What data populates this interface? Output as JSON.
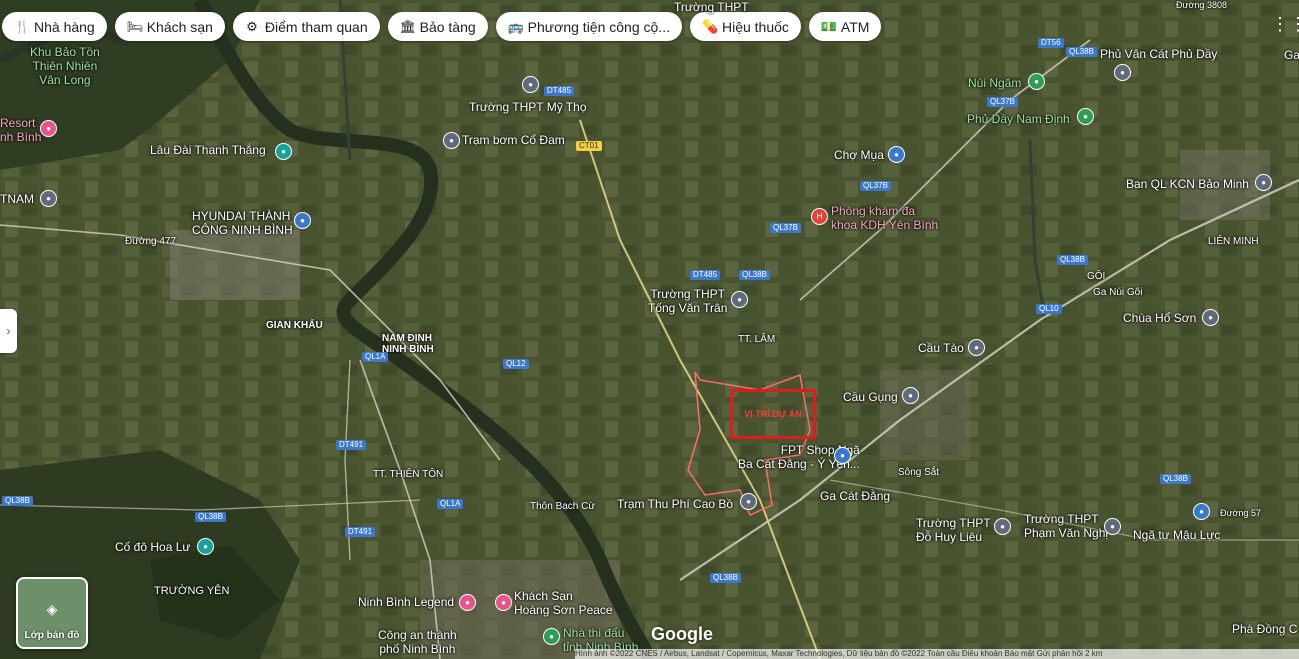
{
  "chips": [
    {
      "icon": "🍴",
      "label": "Nhà hàng"
    },
    {
      "icon": "🛏",
      "label": "Khách sạn"
    },
    {
      "icon": "⚙",
      "label": "Điểm tham quan"
    },
    {
      "icon": "🏛",
      "label": "Bảo tàng"
    },
    {
      "icon": "🚌",
      "label": "Phương tiện công cộ..."
    },
    {
      "icon": "💊",
      "label": "Hiệu thuốc"
    },
    {
      "icon": "💵",
      "label": "ATM"
    }
  ],
  "grid_icon": "apps-grid-icon",
  "side_toggle": "›",
  "layer_button": {
    "label": "Lớp bản đồ",
    "icon": "layers-icon"
  },
  "brand": "Google",
  "footer": "Hình ảnh ©2022 CNES / Airbus, Landsat / Copernicus, Maxar Technologies, Dữ liệu bản đồ ©2022   Toàn cầu   Điều khoản   Bảo mật   Gửi phản hồi   2 km",
  "project_label": "VỊ TRÍ DỰ ÁN",
  "places": [
    {
      "t": "Khu Bảo Tồn\nThiên Nhiên\nVân Long",
      "c": "green"
    },
    {
      "t": "Resort\nnh Bình",
      "c": "pink"
    },
    {
      "t": "Lâu Đài Thanh Thắng",
      "c": ""
    },
    {
      "t": "HYUNDAI THÀNH\nCÔNG NINH BÌNH",
      "c": ""
    },
    {
      "t": "TNAM",
      "c": ""
    },
    {
      "t": "Đường 477",
      "c": ""
    },
    {
      "t": "GIAN KHẨU",
      "c": "bold"
    },
    {
      "t": "NAM ĐỊNH\nNINH BÌNH",
      "c": "bold"
    },
    {
      "t": "TT. THIÊN TÔN",
      "c": ""
    },
    {
      "t": "Cố đô Hoa Lư",
      "c": ""
    },
    {
      "t": "TRƯỜNG YÊN",
      "c": ""
    },
    {
      "t": "Ninh Bình Legend",
      "c": ""
    },
    {
      "t": "Khách Sạn\nHoàng Sơn Peace",
      "c": ""
    },
    {
      "t": "Công an thành\nphố Ninh Bình",
      "c": ""
    },
    {
      "t": "Nhà thi đấu\ntỉnh Ninh Bình",
      "c": "green"
    },
    {
      "t": "Thôn Bạch Cừ",
      "c": ""
    },
    {
      "t": "Trạm Thu Phí Cao Bồ",
      "c": ""
    },
    {
      "t": "Trường THPT Mỹ Thọ",
      "c": ""
    },
    {
      "t": "Trạm bơm Cổ Đam",
      "c": ""
    },
    {
      "t": "Trường THPT\nTống Văn Trân",
      "c": ""
    },
    {
      "t": "TT. LÂM",
      "c": ""
    },
    {
      "t": "Chợ Mụa",
      "c": ""
    },
    {
      "t": "Phòng khám đa\nkhoa KDH Yên Bình",
      "c": "pink"
    },
    {
      "t": "FPT Shop Ngã\nBa Cát Đằng - Ý Yên...",
      "c": ""
    },
    {
      "t": "Ga Cát Đằng",
      "c": ""
    },
    {
      "t": "Cầu Gụng",
      "c": ""
    },
    {
      "t": "Cầu Tào",
      "c": ""
    },
    {
      "t": "Sông Sắt",
      "c": ""
    },
    {
      "t": "Trường THPT\nĐỗ Huy Liêu",
      "c": ""
    },
    {
      "t": "Trường THPT\nPhạm Văn Nghị",
      "c": ""
    },
    {
      "t": "Ngã tư Mậu Lực",
      "c": ""
    },
    {
      "t": "Chùa Hổ Sơn",
      "c": ""
    },
    {
      "t": "Ga Núi Gôi",
      "c": ""
    },
    {
      "t": "GÔI",
      "c": ""
    },
    {
      "t": "LIÊN MINH",
      "c": ""
    },
    {
      "t": "Ban QL KCN Bảo Minh",
      "c": ""
    },
    {
      "t": "Núi Ngăm",
      "c": "green"
    },
    {
      "t": "Phủ Dầy Nam Định",
      "c": "green"
    },
    {
      "t": "Phủ Vân Cát Phủ Dầy",
      "c": ""
    },
    {
      "t": "Trường THPT",
      "c": ""
    },
    {
      "t": "Phà Đồng C",
      "c": ""
    },
    {
      "t": "Ga",
      "c": ""
    }
  ],
  "roads": [
    "DT485",
    "CT01",
    "DT485",
    "QL38B",
    "QL37B",
    "QL37B",
    "QL37B",
    "QL38B",
    "DT56",
    "QL38B",
    "QL10",
    "QL12",
    "QL1A",
    "DT491",
    "QL1A",
    "DT491",
    "QL38B",
    "QL38B",
    "QL38B",
    "Đường 57",
    "QL38B",
    "Đường 3808"
  ]
}
